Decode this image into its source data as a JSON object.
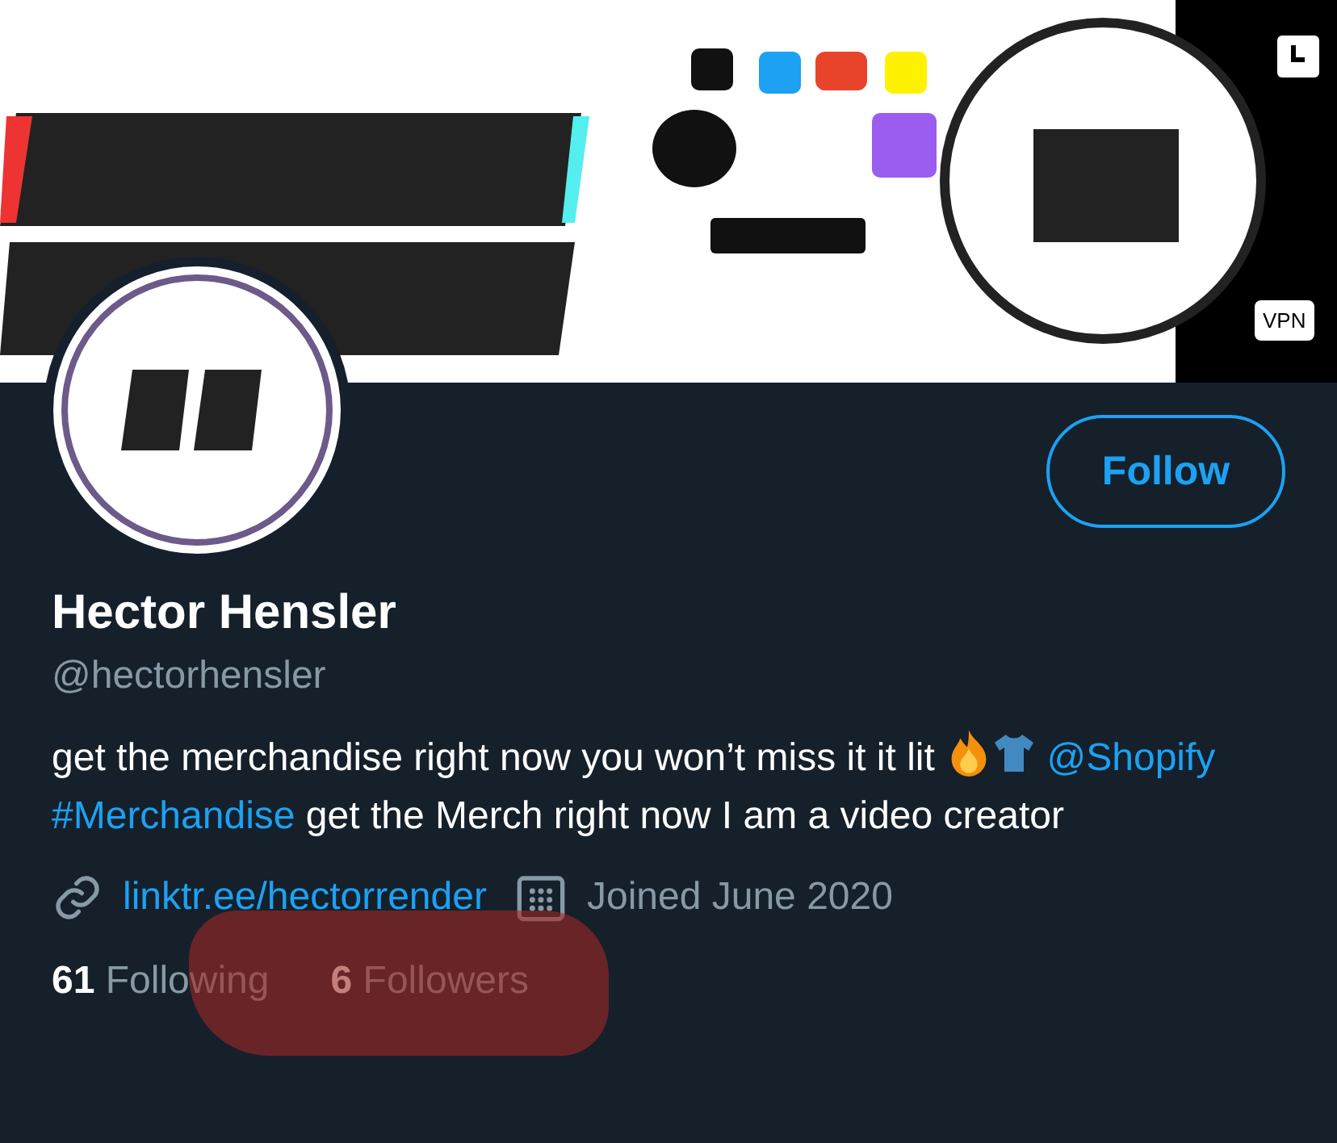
{
  "status_badge": "VPN",
  "profile": {
    "follow_button": "Follow",
    "name": "Hector Hensler",
    "handle": "@hectorhensler"
  },
  "bio": [
    {
      "kind": "text",
      "text": "get the merchandise right now you won’t miss it it lit"
    },
    {
      "kind": "emoji_fire"
    },
    {
      "kind": "emoji_shirt"
    },
    {
      "kind": "link",
      "text": "@Shopify"
    },
    {
      "kind": "link",
      "text": "#Merchandise"
    },
    {
      "kind": "text",
      "text": "get the Merch right now I am a video creator"
    }
  ],
  "meta": {
    "website": "linktr.ee/hectorrender",
    "joined": "Joined June 2020"
  },
  "stats": [
    {
      "count": "61",
      "label": "Following",
      "highlighted": false
    },
    {
      "count": "6",
      "label": "Followers",
      "highlighted": true
    }
  ]
}
